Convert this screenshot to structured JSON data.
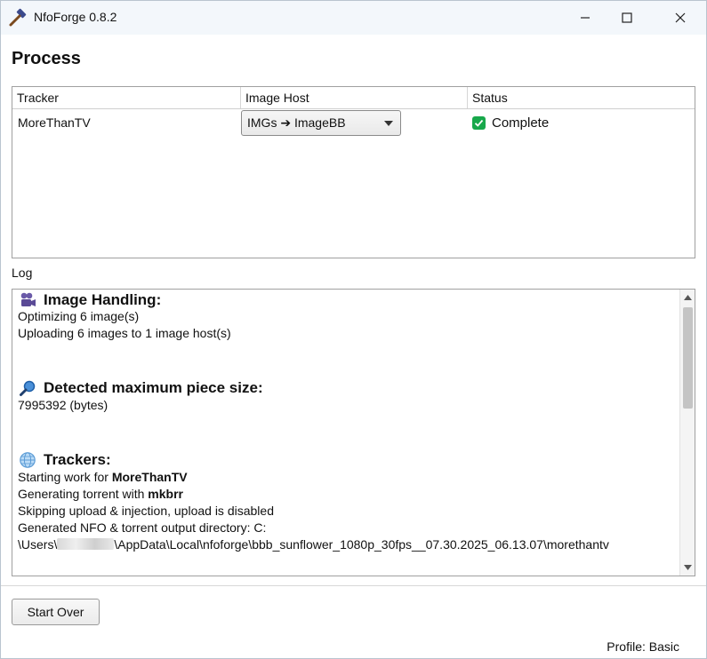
{
  "window": {
    "title": "NfoForge 0.8.2",
    "controls": [
      "minimize-icon",
      "maximize-icon",
      "close-icon"
    ]
  },
  "page": {
    "heading": "Process"
  },
  "table": {
    "columns": [
      "Tracker",
      "Image Host",
      "Status"
    ],
    "rows": [
      {
        "tracker": "MoreThanTV",
        "image_host": "IMGs ➔ ImageBB",
        "status": "Complete"
      }
    ]
  },
  "log": {
    "label": "Log",
    "sections": [
      {
        "icon": "film-projector-icon",
        "title": "Image Handling:"
      },
      {
        "icon": "magnifier-icon",
        "title": "Detected maximum piece size:"
      },
      {
        "icon": "globe-icon",
        "title": "Trackers:"
      }
    ],
    "lines": {
      "optimizing": "Optimizing 6 image(s)",
      "uploading": "Uploading 6 images to 1 image host(s)",
      "piece_size": "7995392 (bytes)",
      "starting_prefix": "Starting work for ",
      "starting_bold": "MoreThanTV",
      "generating_prefix": "Generating torrent with ",
      "generating_bold": "mkbrr",
      "skipping": "Skipping upload & injection, upload is disabled",
      "output_dir": "Generated NFO & torrent output directory: C:",
      "path_prefix": "\\Users\\",
      "path_suffix": "\\AppData\\Local\\nfoforge\\bbb_sunflower_1080p_30fps__07.30.2025_06.13.07\\morethantv"
    }
  },
  "footer": {
    "start_over": "Start Over",
    "profile": "Profile: Basic"
  },
  "colors": {
    "status_complete": "#18a84b",
    "titlebar": "#f3f7fb"
  }
}
